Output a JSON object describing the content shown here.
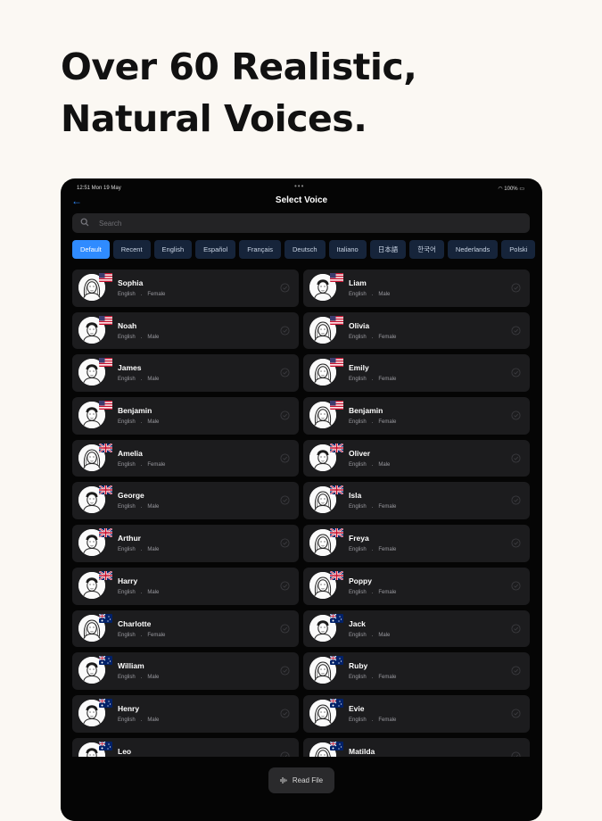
{
  "headline": {
    "line1": "Over 60 Realistic,",
    "line2": "Natural Voices."
  },
  "status": {
    "time": "12:51  Mon 19 May",
    "right": "100%"
  },
  "nav": {
    "back_icon": "back-arrow-icon",
    "title": "Select Voice"
  },
  "search": {
    "placeholder": "Search",
    "value": ""
  },
  "filters": [
    {
      "label": "Default",
      "active": true
    },
    {
      "label": "Recent",
      "active": false
    },
    {
      "label": "English",
      "active": false
    },
    {
      "label": "Español",
      "active": false
    },
    {
      "label": "Français",
      "active": false
    },
    {
      "label": "Deutsch",
      "active": false
    },
    {
      "label": "Italiano",
      "active": false
    },
    {
      "label": "日本語",
      "active": false
    },
    {
      "label": "한국어",
      "active": false
    },
    {
      "label": "Nederlands",
      "active": false
    },
    {
      "label": "Polski",
      "active": false
    }
  ],
  "voices": [
    {
      "name": "Sophia",
      "language": "English",
      "gender": "Female",
      "flag": "us"
    },
    {
      "name": "Liam",
      "language": "English",
      "gender": "Male",
      "flag": "us"
    },
    {
      "name": "Noah",
      "language": "English",
      "gender": "Male",
      "flag": "us"
    },
    {
      "name": "Olivia",
      "language": "English",
      "gender": "Female",
      "flag": "us"
    },
    {
      "name": "James",
      "language": "English",
      "gender": "Male",
      "flag": "us"
    },
    {
      "name": "Emily",
      "language": "English",
      "gender": "Female",
      "flag": "us"
    },
    {
      "name": "Benjamin",
      "language": "English",
      "gender": "Male",
      "flag": "us"
    },
    {
      "name": "Benjamin",
      "language": "English",
      "gender": "Female",
      "flag": "us"
    },
    {
      "name": "Amelia",
      "language": "English",
      "gender": "Female",
      "flag": "gb"
    },
    {
      "name": "Oliver",
      "language": "English",
      "gender": "Male",
      "flag": "gb"
    },
    {
      "name": "George",
      "language": "English",
      "gender": "Male",
      "flag": "gb"
    },
    {
      "name": "Isla",
      "language": "English",
      "gender": "Female",
      "flag": "gb"
    },
    {
      "name": "Arthur",
      "language": "English",
      "gender": "Male",
      "flag": "gb"
    },
    {
      "name": "Freya",
      "language": "English",
      "gender": "Female",
      "flag": "gb"
    },
    {
      "name": "Harry",
      "language": "English",
      "gender": "Male",
      "flag": "gb"
    },
    {
      "name": "Poppy",
      "language": "English",
      "gender": "Female",
      "flag": "gb"
    },
    {
      "name": "Charlotte",
      "language": "English",
      "gender": "Female",
      "flag": "au"
    },
    {
      "name": "Jack",
      "language": "English",
      "gender": "Male",
      "flag": "au"
    },
    {
      "name": "William",
      "language": "English",
      "gender": "Male",
      "flag": "au"
    },
    {
      "name": "Ruby",
      "language": "English",
      "gender": "Female",
      "flag": "au"
    },
    {
      "name": "Henry",
      "language": "English",
      "gender": "Male",
      "flag": "au"
    },
    {
      "name": "Evie",
      "language": "English",
      "gender": "Female",
      "flag": "au"
    },
    {
      "name": "Leo",
      "language": "",
      "gender": "",
      "flag": "au"
    },
    {
      "name": "Matilda",
      "language": "",
      "gender": "",
      "flag": "au"
    }
  ],
  "meta_separator": ".",
  "read_file": {
    "label": "Read File",
    "icon": "waveform-icon"
  },
  "colors": {
    "accent": "#2f8bff",
    "background": "#fbf8f3",
    "device": "#050505",
    "card": "#1c1c1e"
  }
}
